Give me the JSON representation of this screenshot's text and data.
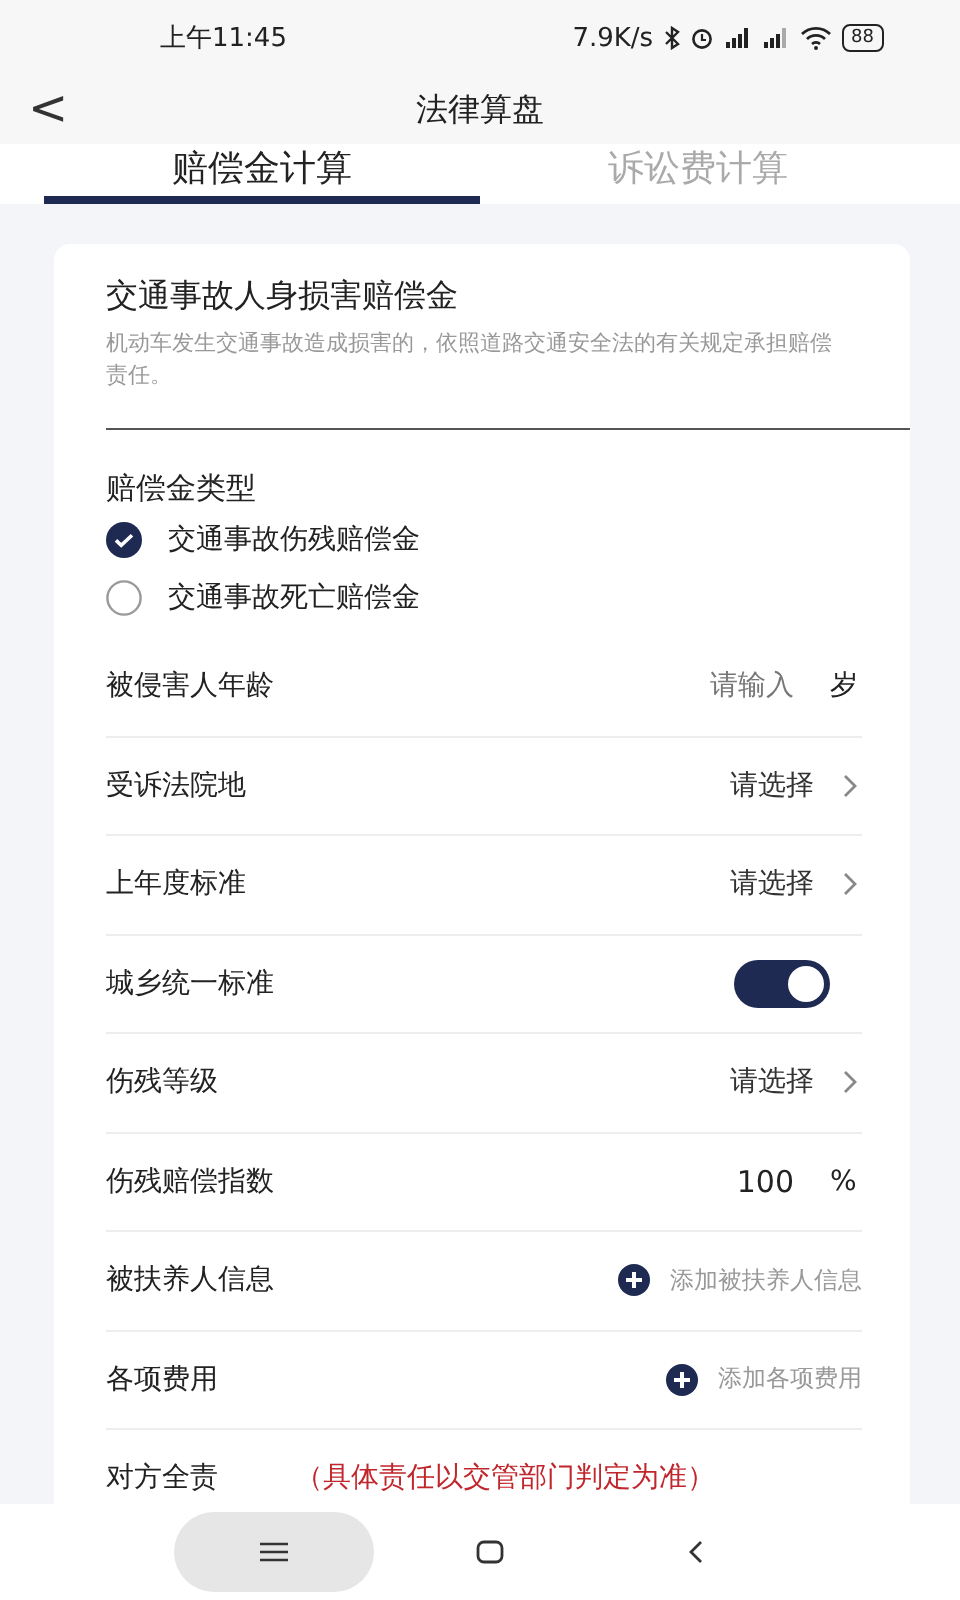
{
  "status_bar": {
    "time": "上午11:45",
    "speed": "7.9K/s",
    "battery": "88"
  },
  "header": {
    "back": "<",
    "title": "法律算盘"
  },
  "tabs": [
    {
      "label": "赔偿金计算",
      "selected": true
    },
    {
      "label": "诉讼费计算",
      "selected": false
    }
  ],
  "card": {
    "title": "交通事故人身损害赔偿金",
    "description": "机动车发生交通事故造成损害的，依照道路交通安全法的有关规定承担赔偿责任。",
    "type_label": "赔偿金类型",
    "options": [
      {
        "label": "交通事故伤残赔偿金",
        "selected": true
      },
      {
        "label": "交通事故死亡赔偿金",
        "selected": false
      }
    ],
    "rows": [
      {
        "kind": "input",
        "label": "被侵害人年龄",
        "placeholder": "请输入",
        "unit": "岁"
      },
      {
        "kind": "select",
        "label": "受诉法院地",
        "value": "请选择"
      },
      {
        "kind": "select",
        "label": "上年度标准",
        "value": "请选择"
      },
      {
        "kind": "toggle",
        "label": "城乡统一标准",
        "on": true
      },
      {
        "kind": "select",
        "label": "伤残等级",
        "value": "请选择"
      },
      {
        "kind": "value",
        "label": "伤残赔偿指数",
        "value": "100",
        "unit": "%"
      },
      {
        "kind": "add",
        "label": "被扶养人信息",
        "value": "添加被扶养人信息"
      },
      {
        "kind": "add",
        "label": "各项费用",
        "value": "添加各项费用"
      },
      {
        "kind": "note",
        "label": "对方全责",
        "value": "（具体责任以交管部门判定为准）"
      }
    ]
  }
}
